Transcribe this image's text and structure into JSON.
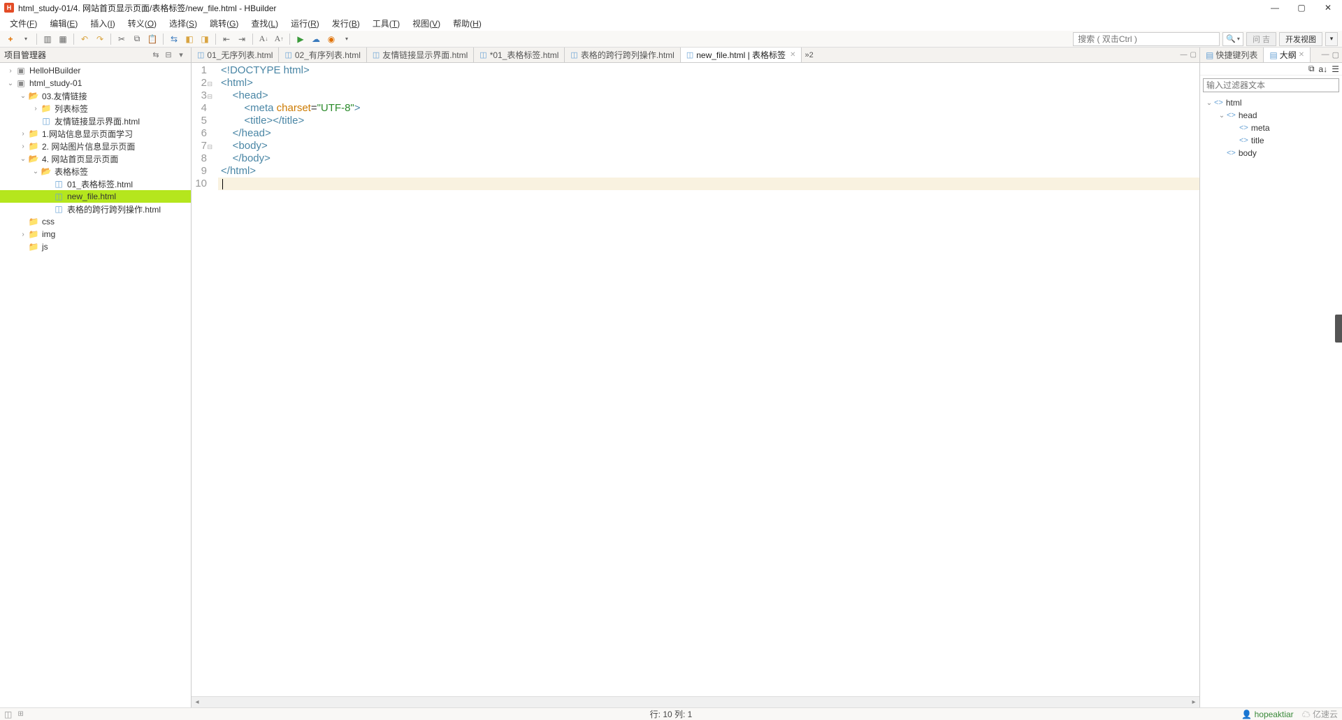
{
  "window": {
    "title": "html_study-01/4. 网站首页显示页面/表格标签/new_file.html  -  HBuilder",
    "app_icon_letter": "H"
  },
  "menu": [
    {
      "label": "文件",
      "key": "F"
    },
    {
      "label": "编辑",
      "key": "E"
    },
    {
      "label": "插入",
      "key": "I"
    },
    {
      "label": "转义",
      "key": "O"
    },
    {
      "label": "选择",
      "key": "S"
    },
    {
      "label": "跳转",
      "key": "G"
    },
    {
      "label": "查找",
      "key": "L"
    },
    {
      "label": "运行",
      "key": "R"
    },
    {
      "label": "发行",
      "key": "B"
    },
    {
      "label": "工具",
      "key": "T"
    },
    {
      "label": "视图",
      "key": "V"
    },
    {
      "label": "帮助",
      "key": "H"
    }
  ],
  "toolbar": {
    "search_placeholder": "搜索 ( 双击Ctrl )",
    "search_icon": "🔍",
    "btn_q": "问 吉",
    "btn_dev": "开发视图"
  },
  "sidebar": {
    "title": "项目管理器",
    "tree": [
      {
        "depth": 0,
        "arrow": "›",
        "icon": "proj",
        "label": "HelloHBuilder"
      },
      {
        "depth": 0,
        "arrow": "⌄",
        "icon": "proj",
        "label": "html_study-01"
      },
      {
        "depth": 1,
        "arrow": "⌄",
        "icon": "folder-open",
        "label": "03.友情链接"
      },
      {
        "depth": 2,
        "arrow": "›",
        "icon": "folder",
        "label": "列表标签"
      },
      {
        "depth": 2,
        "arrow": "",
        "icon": "file",
        "label": "友情链接显示界面.html"
      },
      {
        "depth": 1,
        "arrow": "›",
        "icon": "folder",
        "label": "1.网站信息显示页面学习"
      },
      {
        "depth": 1,
        "arrow": "›",
        "icon": "folder",
        "label": "2. 网站图片信息显示页面"
      },
      {
        "depth": 1,
        "arrow": "⌄",
        "icon": "folder-open",
        "label": "4. 网站首页显示页面"
      },
      {
        "depth": 2,
        "arrow": "⌄",
        "icon": "folder-open",
        "label": "表格标签"
      },
      {
        "depth": 3,
        "arrow": "",
        "icon": "file",
        "label": "01_表格标签.html"
      },
      {
        "depth": 3,
        "arrow": "",
        "icon": "file",
        "label": "new_file.html",
        "selected": true
      },
      {
        "depth": 3,
        "arrow": "",
        "icon": "file",
        "label": "表格的跨行跨列操作.html"
      },
      {
        "depth": 1,
        "arrow": "",
        "icon": "folder",
        "label": "css"
      },
      {
        "depth": 1,
        "arrow": "›",
        "icon": "folder",
        "label": "img"
      },
      {
        "depth": 1,
        "arrow": "",
        "icon": "folder",
        "label": "js"
      }
    ]
  },
  "tabs": [
    {
      "label": "01_无序列表.html"
    },
    {
      "label": "02_有序列表.html"
    },
    {
      "label": "友情链接显示界面.html"
    },
    {
      "label": "*01_表格标签.html"
    },
    {
      "label": "表格的跨行跨列操作.html"
    },
    {
      "label": "new_file.html | 表格标签",
      "active": true,
      "closable": true
    }
  ],
  "tab_overflow": "»2",
  "code": {
    "lines": [
      {
        "n": "1",
        "fold": "",
        "html": "<span class='tag-bracket'>&lt;!</span><span class='doctype'>DOCTYPE</span> <span class='keyword'>html</span><span class='tag-bracket'>&gt;</span>"
      },
      {
        "n": "2",
        "fold": "⊟",
        "html": "<span class='tag-bracket'>&lt;</span><span class='tag-name'>html</span><span class='tag-bracket'>&gt;</span>"
      },
      {
        "n": "3",
        "fold": "⊟",
        "html": "    <span class='tag-bracket'>&lt;</span><span class='tag-name'>head</span><span class='tag-bracket'>&gt;</span>"
      },
      {
        "n": "4",
        "fold": "",
        "html": "        <span class='tag-bracket'>&lt;</span><span class='tag-name'>meta</span> <span class='attr-name'>charset</span>=<span class='attr-value'>\"UTF-8\"</span><span class='tag-bracket'>&gt;</span>"
      },
      {
        "n": "5",
        "fold": "",
        "html": "        <span class='tag-bracket'>&lt;</span><span class='tag-name'>title</span><span class='tag-bracket'>&gt;&lt;/</span><span class='tag-name'>title</span><span class='tag-bracket'>&gt;</span>"
      },
      {
        "n": "6",
        "fold": "",
        "html": "    <span class='tag-bracket'>&lt;/</span><span class='tag-name'>head</span><span class='tag-bracket'>&gt;</span>"
      },
      {
        "n": "7",
        "fold": "⊟",
        "html": "    <span class='tag-bracket'>&lt;</span><span class='tag-name'>body</span><span class='tag-bracket'>&gt;</span>"
      },
      {
        "n": "8",
        "fold": "",
        "html": "    <span class='tag-bracket'>&lt;/</span><span class='tag-name'>body</span><span class='tag-bracket'>&gt;</span>"
      },
      {
        "n": "9",
        "fold": "",
        "html": "<span class='tag-bracket'>&lt;/</span><span class='tag-name'>html</span><span class='tag-bracket'>&gt;</span>"
      },
      {
        "n": "10",
        "fold": "",
        "html": "<span class='cursor-bar'></span>",
        "current": true
      }
    ]
  },
  "rightpanel": {
    "tabs": [
      {
        "label": "快捷键列表"
      },
      {
        "label": "大纲",
        "active": true,
        "closable": true
      }
    ],
    "filter_placeholder": "输入过滤器文本",
    "outline": [
      {
        "depth": 0,
        "arrow": "⌄",
        "label": "html"
      },
      {
        "depth": 1,
        "arrow": "⌄",
        "label": "head"
      },
      {
        "depth": 2,
        "arrow": "",
        "label": "meta"
      },
      {
        "depth": 2,
        "arrow": "",
        "label": "title"
      },
      {
        "depth": 1,
        "arrow": "",
        "label": "body"
      }
    ]
  },
  "status": {
    "pos": "行: 10 列: 1",
    "user": "hopeaktiar",
    "cloud": "亿速云"
  }
}
